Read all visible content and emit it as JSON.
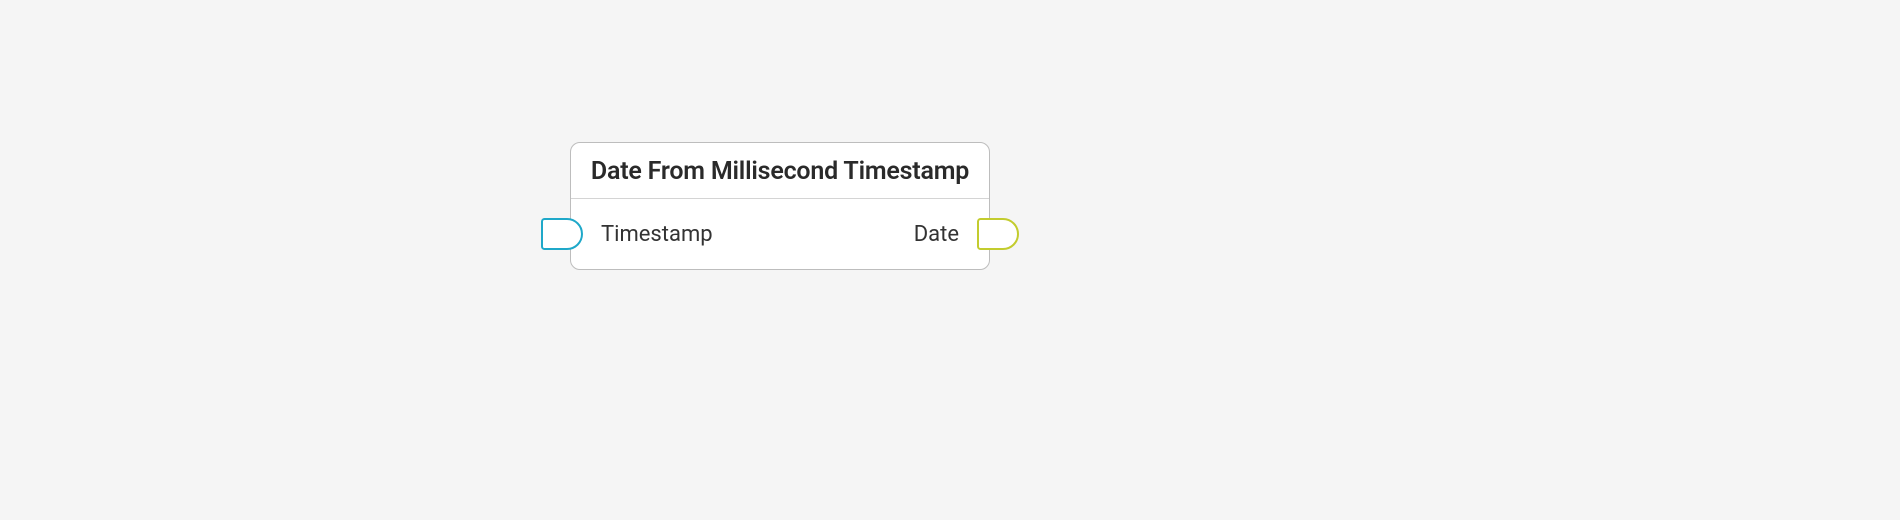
{
  "node": {
    "title": "Date From Millisecond Timestamp",
    "input": {
      "label": "Timestamp",
      "color": "#1fa8c9"
    },
    "output": {
      "label": "Date",
      "color": "#c3cc2e"
    }
  }
}
